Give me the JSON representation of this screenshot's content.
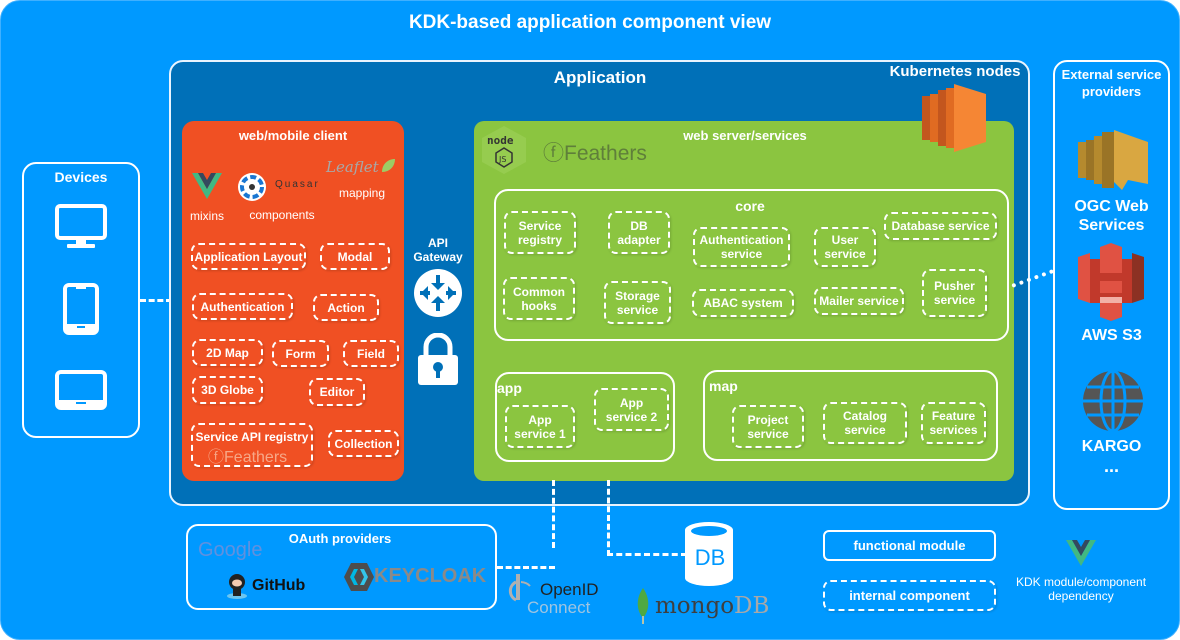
{
  "title": "KDK-based application component view",
  "application": {
    "title": "Application",
    "kubernetes_label": "Kubernetes nodes"
  },
  "devices": {
    "title": "Devices",
    "items": [
      {
        "icon": "desktop-icon"
      },
      {
        "icon": "tablet-portrait-icon"
      },
      {
        "icon": "tablet-landscape-icon"
      }
    ]
  },
  "client": {
    "title": "web/mobile client",
    "libraries": [
      {
        "name": "Vue",
        "caption": "mixins"
      },
      {
        "name": "Quasar",
        "caption": "components"
      },
      {
        "name": "Leaflet",
        "caption": "mapping"
      }
    ],
    "components": [
      "Application Layout",
      "Modal",
      "Authentication",
      "Action",
      "2D Map",
      "Form",
      "Field",
      "3D Globe",
      "Editor",
      "Service API registry",
      "Collection"
    ],
    "feathers_label": "Feathers"
  },
  "gateway": {
    "title_line1": "API",
    "title_line2": "Gateway"
  },
  "server": {
    "title": "web server/services",
    "feathers_label": "Feathers",
    "node_label": "node",
    "core": {
      "title": "core",
      "services": [
        [
          "Service",
          "registry"
        ],
        [
          "DB",
          "adapter"
        ],
        [
          "Authentication",
          "service"
        ],
        [
          "User",
          "service"
        ],
        [
          "Database service"
        ],
        [
          "Common",
          "hooks"
        ],
        [
          "Storage",
          "service"
        ],
        [
          "ABAC system"
        ],
        [
          "Mailer service"
        ],
        [
          "Pusher",
          "service"
        ]
      ]
    },
    "app": {
      "title": "app",
      "services": [
        [
          "App",
          "service 1"
        ],
        [
          "App",
          "service 2"
        ]
      ]
    },
    "map": {
      "title": "map",
      "services": [
        [
          "Project",
          "service"
        ],
        [
          "Catalog",
          "service"
        ],
        [
          "Feature",
          "services"
        ]
      ]
    }
  },
  "external": {
    "title_line1": "External service",
    "title_line2": "providers",
    "providers": [
      [
        "OGC Web",
        "Services"
      ],
      [
        "AWS S3"
      ],
      [
        "KARGO"
      ]
    ],
    "more": "..."
  },
  "oauth": {
    "title": "OAuth providers",
    "providers": [
      "Google",
      "GitHub",
      "KEYCLOAK"
    ]
  },
  "openid": {
    "line1": "OpenID",
    "line2": "Connect"
  },
  "db": {
    "label": "DB",
    "brand": "mongo",
    "brand_suffix": "DB"
  },
  "legend": {
    "functional_module": "functional module",
    "internal_component": "internal component",
    "dependency_line1": "KDK module/component",
    "dependency_line2": "dependency"
  },
  "colors": {
    "background": "#0099ff",
    "application": "#0070b8",
    "client": "#f05023",
    "server": "#8bc540"
  }
}
